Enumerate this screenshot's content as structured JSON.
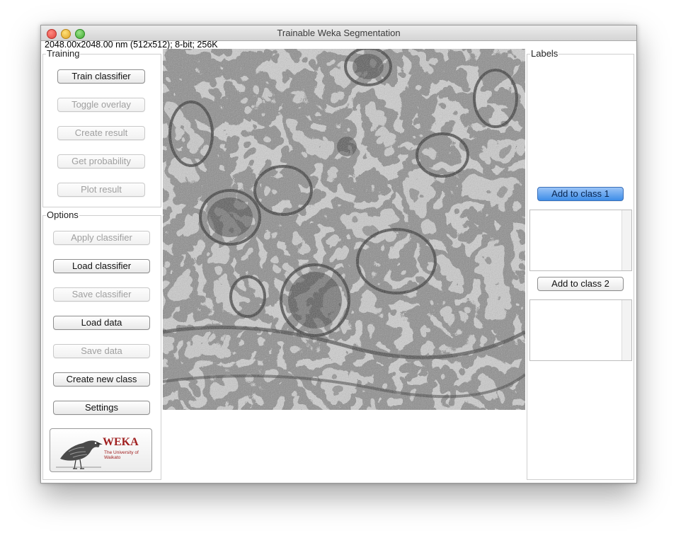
{
  "window": {
    "title": "Trainable Weka Segmentation",
    "image_info": "2048.00x2048.00 nm (512x512); 8-bit; 256K"
  },
  "training": {
    "title": "Training",
    "buttons": [
      {
        "label": "Train classifier",
        "enabled": true
      },
      {
        "label": "Toggle overlay",
        "enabled": false
      },
      {
        "label": "Create result",
        "enabled": false
      },
      {
        "label": "Get probability",
        "enabled": false
      },
      {
        "label": "Plot result",
        "enabled": false
      }
    ]
  },
  "options": {
    "title": "Options",
    "buttons": [
      {
        "label": "Apply classifier",
        "enabled": false
      },
      {
        "label": "Load classifier",
        "enabled": true
      },
      {
        "label": "Save classifier",
        "enabled": false
      },
      {
        "label": "Load data",
        "enabled": true
      },
      {
        "label": "Save data",
        "enabled": false
      },
      {
        "label": "Create new class",
        "enabled": true
      },
      {
        "label": "Settings",
        "enabled": true
      }
    ],
    "logo": {
      "name": "WEKA",
      "subtitle": "The University of Waikato"
    }
  },
  "labels": {
    "title": "Labels",
    "classes": [
      {
        "button": "Add to class 1",
        "selected": true,
        "items": []
      },
      {
        "button": "Add to class 2",
        "selected": false,
        "items": []
      }
    ]
  },
  "colors": {
    "accent": "#3e8de8",
    "logo": "#a02020"
  }
}
